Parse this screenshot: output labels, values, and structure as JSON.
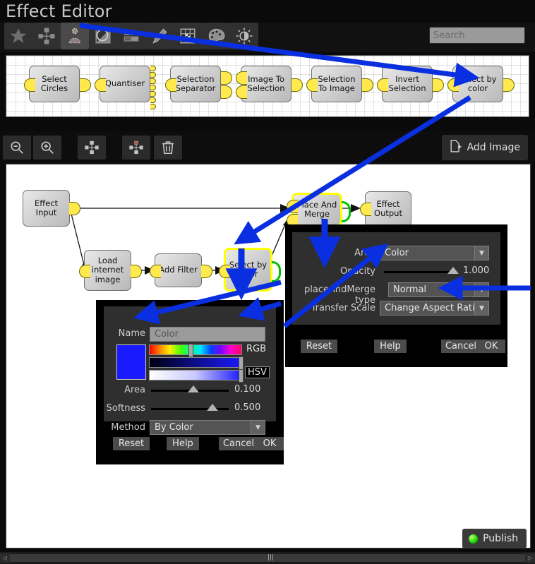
{
  "window": {
    "title": "Effect Editor"
  },
  "toolbar": {
    "buttons": [
      {
        "name": "favourites-star-icon",
        "icon": "star"
      },
      {
        "name": "node-graph-icon",
        "icon": "nodes"
      },
      {
        "name": "puppet-icon",
        "icon": "puppet"
      },
      {
        "name": "contrast-icon",
        "icon": "contrast"
      },
      {
        "name": "layers-icon",
        "icon": "layers"
      },
      {
        "name": "brush-icon",
        "icon": "brush"
      },
      {
        "name": "checker-grid-icon",
        "icon": "grid"
      },
      {
        "name": "palette-icon",
        "icon": "palette"
      },
      {
        "name": "brightness-icon",
        "icon": "brightness"
      }
    ],
    "selected_index": 2
  },
  "search": {
    "placeholder": "Search",
    "value": "",
    "icon": "search-icon"
  },
  "palette": {
    "nodes": [
      {
        "label": "Select Circles",
        "lines": [
          "Select",
          "Circles"
        ]
      },
      {
        "label": "Quantiser",
        "lines": [
          "Quantiser"
        ]
      },
      {
        "label": "Selection Separator",
        "lines": [
          "Selection",
          "Separator"
        ]
      },
      {
        "label": "Image To Selection",
        "lines": [
          "Image To",
          "Selection"
        ]
      },
      {
        "label": "Selection To Image",
        "lines": [
          "Selection",
          "To Image"
        ]
      },
      {
        "label": "Invert Selection",
        "lines": [
          "Invert",
          "Selection"
        ]
      },
      {
        "label": "Select by color",
        "lines": [
          "Select by",
          "color"
        ]
      }
    ]
  },
  "toolbar2": {
    "buttons": [
      {
        "name": "zoom-out-button",
        "icon": "zoom-out"
      },
      {
        "name": "zoom-in-button",
        "icon": "zoom-in"
      },
      {
        "name": "add-node-button",
        "icon": "node-add"
      },
      {
        "name": "remove-node-button",
        "icon": "node-remove"
      },
      {
        "name": "delete-button",
        "icon": "trash"
      }
    ],
    "add_image_label": "Add Image"
  },
  "canvas": {
    "nodes": [
      {
        "label": "Effect Input",
        "lines": [
          "Effect",
          "Input"
        ]
      },
      {
        "label": "Load internet image",
        "lines": [
          "Load",
          "internet",
          "image"
        ]
      },
      {
        "label": "Add Filter",
        "lines": [
          "Add Filter"
        ]
      },
      {
        "label": "Select by color",
        "lines": [
          "Select by",
          "color"
        ]
      },
      {
        "label": "Place And Merge",
        "lines": [
          "Place And",
          "Merge"
        ]
      },
      {
        "label": "Effect Output",
        "lines": [
          "Effect",
          "Output"
        ]
      }
    ]
  },
  "place_merge_dialog": {
    "fields": {
      "area_label": "Area",
      "area_value": "Color",
      "opacity_label": "Opacity",
      "opacity_value": "1.000",
      "type_label": "placeAndMerge type",
      "type_value": "Normal",
      "scale_label": "Transfer Scale",
      "scale_value": "Change Aspect Ratio"
    },
    "buttons": {
      "reset": "Reset",
      "help": "Help",
      "cancel": "Cancel",
      "ok": "OK"
    }
  },
  "select_color_dialog": {
    "fields": {
      "name_label": "Name",
      "name_value": "Color",
      "rgb_label": "RGB",
      "hsv_label": "HSV",
      "area_label": "Area",
      "area_value": "0.100",
      "softness_label": "Softness",
      "softness_value": "0.500",
      "method_label": "Method",
      "method_value": "By Color"
    },
    "swatch_color": "#1a1aff",
    "buttons": {
      "reset": "Reset",
      "help": "Help",
      "cancel": "Cancel",
      "ok": "OK"
    }
  },
  "publish": {
    "label": "Publish",
    "led_color": "#19d400"
  },
  "scrollbar": {
    "left_arrow": "◁",
    "right_arrow": "▷",
    "grip": "|||"
  },
  "colors": {
    "highlight": "#ffff00",
    "annotation": "#0a2fe0",
    "port": "#ffe94d",
    "green_port": "#00c000"
  }
}
